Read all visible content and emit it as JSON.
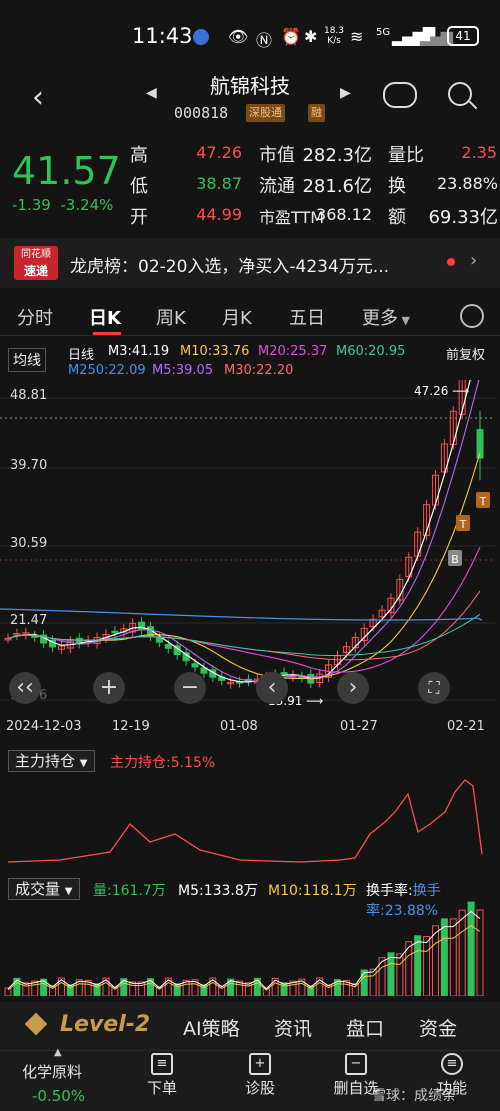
{
  "status": {
    "time": "11:43",
    "net_speed": "18.3 K/s",
    "battery": "41",
    "net": "5G"
  },
  "header": {
    "name": "航锦科技",
    "code": "000818",
    "badge1": "深股通",
    "badge2": "融"
  },
  "quote": {
    "price": "41.57",
    "change": "-1.39",
    "change_pct": "-3.24%",
    "high_label": "高",
    "high": "47.26",
    "low_label": "低",
    "low": "38.87",
    "open_label": "开",
    "open": "44.99",
    "mktcap_label": "市值",
    "mktcap": "282.3亿",
    "float_label": "流通",
    "float": "281.6亿",
    "pe_label": "市盈TTM",
    "pe": "368.12",
    "volratio_label": "量比",
    "volratio": "2.35",
    "turnover_label": "换",
    "turnover": "23.88%",
    "amount_label": "额",
    "amount": "69.33亿"
  },
  "news": {
    "logo_top": "同花顺",
    "logo_bottom": "速递",
    "text": "龙虎榜：02-20入选，净买入-4234万元..."
  },
  "tabs": [
    "分时",
    "日K",
    "周K",
    "月K",
    "五日",
    "更多"
  ],
  "indicators": {
    "ma_btn": "均线",
    "period": "日线",
    "m3": "M3:41.19",
    "m10": "M10:33.76",
    "m20": "M20:25.37",
    "m60": "M60:20.95",
    "adjust": "前复权",
    "m250": "M250:22.09",
    "m5": "M5:39.05",
    "m30": "M30:22.20"
  },
  "chart": {
    "y_labels": [
      "48.81",
      "39.70",
      "30.59",
      "21.47",
      "12.36"
    ],
    "dates": [
      "2024-12-03",
      "12-19",
      "01-08",
      "01-27",
      "02-21"
    ],
    "high_mark": "47.26",
    "low_mark": "13.91",
    "colors": {
      "up": "#ff4d4f",
      "down": "#2fc25b",
      "m3": "#ffffff",
      "m5": "#b26cf0",
      "m10": "#f5c842",
      "m20": "#e54bd6",
      "m30": "#ff6b6b",
      "m60": "#3ec7a4",
      "m250": "#4a90e2"
    }
  },
  "holding": {
    "btn": "主力持仓",
    "value": "主力持仓:5.15%"
  },
  "volume": {
    "btn": "成交量",
    "vol": "量:161.7万",
    "m5": "M5:133.8万",
    "m10": "M10:118.1万",
    "turnover": "换手率:23.88%"
  },
  "level2": {
    "brand": "Level-2",
    "items": [
      "AI策略",
      "资讯",
      "盘口",
      "资金"
    ]
  },
  "bottom": {
    "sector": "化学原料",
    "sector_chg": "-0.50%",
    "items": [
      "下单",
      "诊股",
      "删自选",
      "功能"
    ],
    "watermark": "雪球：成绩条"
  }
}
